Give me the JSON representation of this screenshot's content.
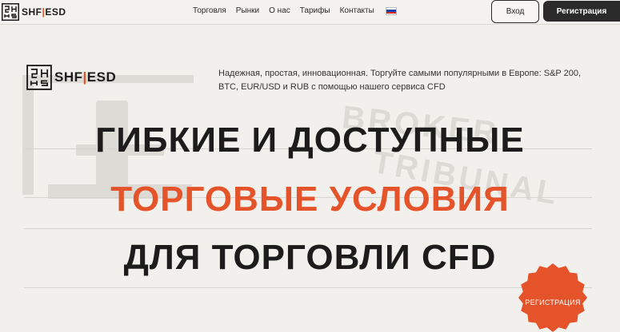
{
  "header": {
    "logo_text_left": "SHF",
    "logo_text_sep": "|",
    "logo_text_right": "ESD",
    "nav": [
      {
        "label": "Торговля"
      },
      {
        "label": "Рынки"
      },
      {
        "label": "О нас"
      },
      {
        "label": "Тарифы"
      },
      {
        "label": "Контакты"
      }
    ],
    "language_flag": "russian-flag-icon",
    "login_label": "Вход",
    "register_label": "Регистрация"
  },
  "hero": {
    "logo_text_left": "SHF",
    "logo_text_sep": "|",
    "logo_text_right": "ESD",
    "tagline": "Надежная, простая, инновационная. Торгуйте самыми популярными в Европе: S&P 200, BTC, EUR/USD и RUB с помощью нашего сервиса CFD",
    "headline_line1": "ГИБКИЕ И ДОСТУПНЫЕ",
    "headline_line2": "ТОРГОВЫЕ УСЛОВИЯ",
    "headline_line3": "ДЛЯ ТОРГОВЛИ CFD",
    "badge_label": "РЕГИСТРАЦИЯ"
  },
  "watermark": {
    "line1": "BROKER",
    "line2": "TRIBUNAL"
  },
  "colors": {
    "accent": "#e5532a",
    "dark": "#2b2b2b",
    "background": "#f1f0ec"
  }
}
